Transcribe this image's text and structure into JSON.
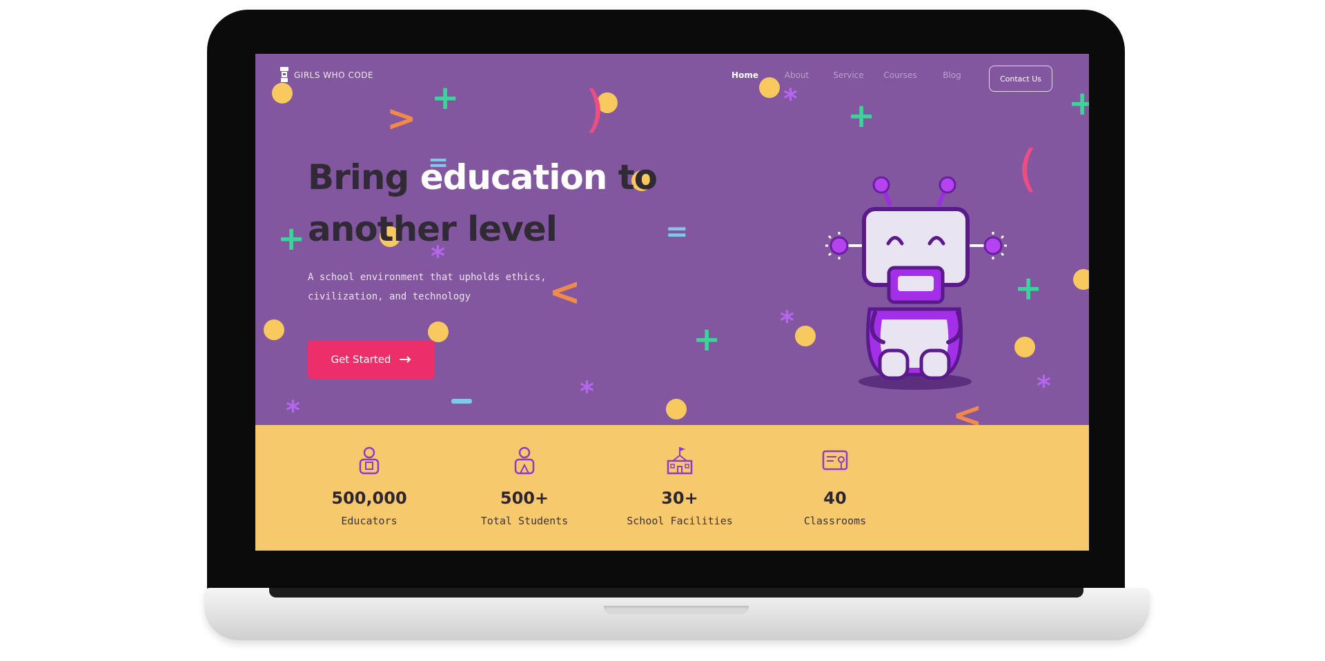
{
  "brand": {
    "name": "GIRLS WHO CODE"
  },
  "nav": {
    "links": [
      {
        "label": "Home"
      },
      {
        "label": "About"
      },
      {
        "label": "Service"
      },
      {
        "label": "Courses"
      },
      {
        "label": "Blog"
      }
    ],
    "contact_label": "Contact Us"
  },
  "hero": {
    "headline_part1": "Bring ",
    "headline_highlight": "education",
    "headline_part2": " to another level",
    "subtitle": "A school environment that upholds ethics, civilization, and technology",
    "cta_label": "Get Started",
    "cta_icon": "arrow-right-icon"
  },
  "stats": [
    {
      "value": "500,000",
      "label": "Educators",
      "icon": "educator-icon"
    },
    {
      "value": "500+",
      "label": "Total Students",
      "icon": "student-icon"
    },
    {
      "value": "30+",
      "label": "School Facilities",
      "icon": "school-building-icon"
    },
    {
      "value": "40",
      "label": "Classrooms",
      "icon": "classroom-board-icon"
    }
  ],
  "colors": {
    "hero_bg": "#82579F",
    "accent_pink": "#EC2E6B",
    "stats_bg": "#F6C96C",
    "deco_green": "#3DD39A",
    "deco_yellow": "#F7C95E",
    "deco_orange": "#F08A4B",
    "deco_purple": "#B466F0",
    "deco_blue": "#7FC8E8"
  }
}
